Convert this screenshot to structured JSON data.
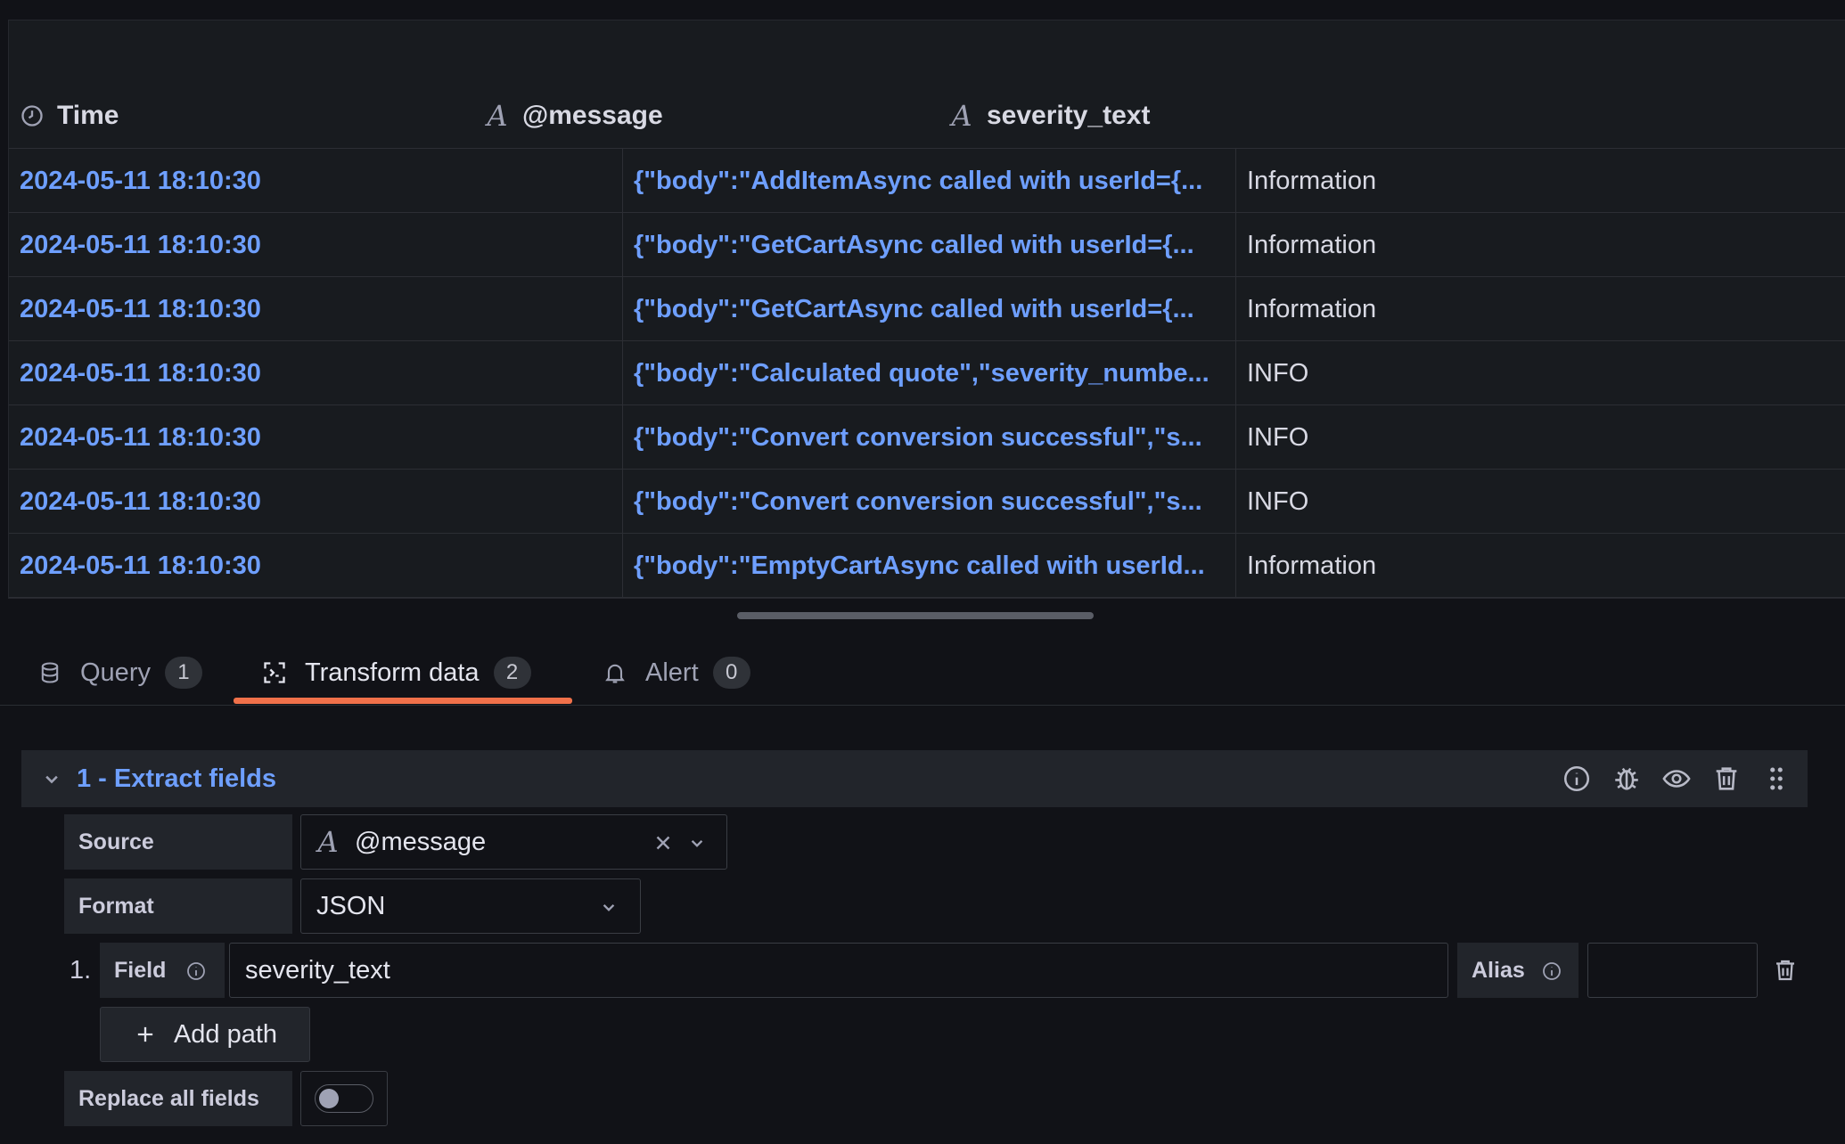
{
  "table": {
    "columns": [
      {
        "label": "Time",
        "icon": "clock-icon"
      },
      {
        "label": "@message",
        "icon": "string-field-icon",
        "icon_glyph": "A"
      },
      {
        "label": "severity_text",
        "icon": "string-field-icon",
        "icon_glyph": "A"
      }
    ],
    "rows": [
      {
        "time": "2024-05-11 18:10:30",
        "message": "{\"body\":\"AddItemAsync called with userId={...",
        "severity": "Information"
      },
      {
        "time": "2024-05-11 18:10:30",
        "message": "{\"body\":\"GetCartAsync called with userId={...",
        "severity": "Information"
      },
      {
        "time": "2024-05-11 18:10:30",
        "message": "{\"body\":\"GetCartAsync called with userId={...",
        "severity": "Information"
      },
      {
        "time": "2024-05-11 18:10:30",
        "message": "{\"body\":\"Calculated quote\",\"severity_numbe...",
        "severity": "INFO"
      },
      {
        "time": "2024-05-11 18:10:30",
        "message": "{\"body\":\"Convert conversion successful\",\"s...",
        "severity": "INFO"
      },
      {
        "time": "2024-05-11 18:10:30",
        "message": "{\"body\":\"Convert conversion successful\",\"s...",
        "severity": "INFO"
      },
      {
        "time": "2024-05-11 18:10:30",
        "message": "{\"body\":\"EmptyCartAsync called with userId...",
        "severity": "Information"
      }
    ]
  },
  "tabs": [
    {
      "label": "Query",
      "count": "1",
      "icon": "database-icon"
    },
    {
      "label": "Transform data",
      "count": "2",
      "icon": "transform-icon",
      "active": true
    },
    {
      "label": "Alert",
      "count": "0",
      "icon": "bell-icon"
    }
  ],
  "transform": {
    "title": "1 - Extract fields",
    "actions": [
      "info-icon",
      "debug-icon",
      "eye-icon",
      "trash-icon",
      "drag-handle-icon"
    ],
    "source": {
      "label": "Source",
      "value": "@message",
      "glyph": "A"
    },
    "format": {
      "label": "Format",
      "value": "JSON"
    },
    "paths": [
      {
        "index": "1.",
        "field_label": "Field",
        "field_value": "severity_text",
        "alias_label": "Alias",
        "alias_value": ""
      }
    ],
    "add_path_label": "Add path",
    "replace_all": {
      "label": "Replace all fields",
      "enabled": false
    }
  },
  "colors": {
    "accent_link": "#6e9fff",
    "active_tab_underline": "#f0714a",
    "background": "#111217"
  }
}
